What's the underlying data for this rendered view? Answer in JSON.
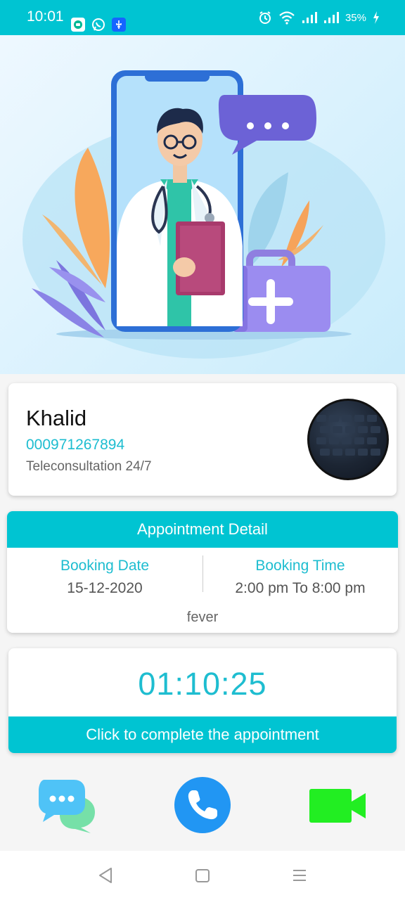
{
  "status_bar": {
    "time": "10:01",
    "battery": "35%",
    "notification_icons": [
      "chat-bubble-icon",
      "whatsapp-icon",
      "usb-icon"
    ],
    "system_icons": [
      "alarm-icon",
      "wifi-icon",
      "signal-icon",
      "signal-icon",
      "battery-icon",
      "charging-icon"
    ]
  },
  "profile": {
    "name": "Khalid",
    "phone": "000971267894",
    "service": "Teleconsultation 24/7"
  },
  "appointment": {
    "title": "Appointment Detail",
    "booking_date_label": "Booking Date",
    "booking_date": "15-12-2020",
    "booking_time_label": "Booking Time",
    "booking_time": "2:00 pm To 8:00 pm",
    "reason": "fever"
  },
  "timer": {
    "elapsed": "01:10:25",
    "complete_label": "Click to complete the appointment"
  },
  "actions": [
    "chat-icon",
    "phone-call-icon",
    "video-call-icon"
  ],
  "colors": {
    "accent": "#00c4d2",
    "accent_text": "#1ebdd0",
    "call_button": "#2196f3",
    "video_icon": "#22ee22"
  }
}
